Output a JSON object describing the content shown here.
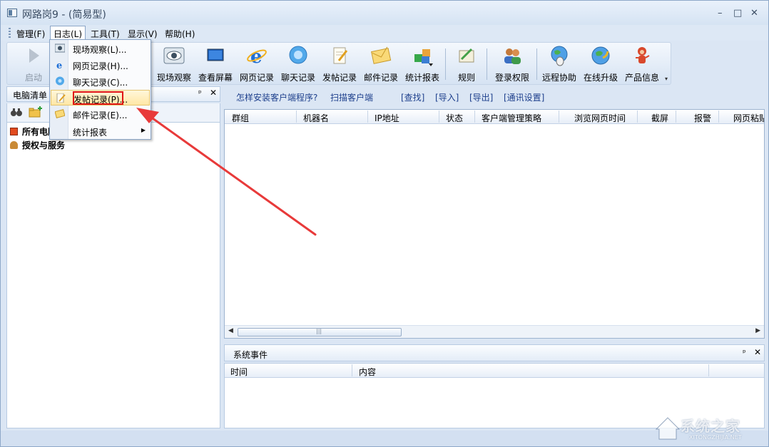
{
  "window": {
    "title": "网路岗9 - (简易型)",
    "minimize": "–",
    "maximize": "□",
    "close": "✕"
  },
  "menubar": [
    {
      "label": "管理(F)"
    },
    {
      "label": "日志(L)"
    },
    {
      "label": "工具(T)"
    },
    {
      "label": "显示(V)"
    },
    {
      "label": "帮助(H)"
    }
  ],
  "log_menu": {
    "items": [
      {
        "label": "现场观察(L)...",
        "icon": "eye-icon"
      },
      {
        "label": "网页记录(H)...",
        "icon": "ie-icon"
      },
      {
        "label": "聊天记录(C)...",
        "icon": "chat-icon"
      },
      {
        "label": "发帖记录(P)...",
        "icon": "post-icon",
        "highlighted": true
      },
      {
        "label": "邮件记录(E)...",
        "icon": "mail-icon"
      },
      {
        "label": "统计报表",
        "icon": "",
        "submenu": "▶"
      }
    ]
  },
  "toolbar": {
    "buttons": [
      {
        "label": "启动",
        "icon": "play-icon",
        "disabled": true
      },
      {
        "label": "现场观察",
        "icon": "eye-icon"
      },
      {
        "label": "查看屏幕",
        "icon": "monitor-icon"
      },
      {
        "label": "网页记录",
        "icon": "ie-icon"
      },
      {
        "label": "聊天记录",
        "icon": "chat-icon"
      },
      {
        "label": "发帖记录",
        "icon": "post-icon"
      },
      {
        "label": "邮件记录",
        "icon": "mail-icon"
      },
      {
        "label": "统计报表",
        "icon": "cubes-icon"
      },
      {
        "label": "规则",
        "icon": "rule-icon"
      },
      {
        "label": "登录权限",
        "icon": "users-icon"
      },
      {
        "label": "远程协助",
        "icon": "globe-mouse-icon"
      },
      {
        "label": "在线升级",
        "icon": "globe-arrow-icon"
      },
      {
        "label": "产品信息",
        "icon": "mascot-icon"
      }
    ]
  },
  "left_panel": {
    "title": "电脑清单",
    "pin": "ᵖ",
    "close": "✕",
    "tree": [
      {
        "label": "所有电脑",
        "icon": "computers-icon"
      },
      {
        "label": "授权与服务",
        "icon": "service-icon"
      }
    ]
  },
  "links": {
    "install_client": "怎样安装客户端程序?",
    "scan_client": "扫描客户端",
    "find": "[查找]",
    "import": "[导入]",
    "export": "[导出]",
    "comm_settings": "[通讯设置]"
  },
  "table": {
    "columns": [
      "群组",
      "机器名",
      "IP地址",
      "状态",
      "客户端管理策略",
      "浏览网页时间",
      "截屏",
      "报警",
      "网页粘贴"
    ]
  },
  "events": {
    "title": "系统事件",
    "columns": [
      "时间",
      "内容"
    ]
  },
  "watermark": {
    "text": "系统之家",
    "sub": "XITONGZHIJIA.NET"
  },
  "colors": {
    "highlight_red": "#e01414",
    "accent_blue": "#1d3f8c"
  }
}
